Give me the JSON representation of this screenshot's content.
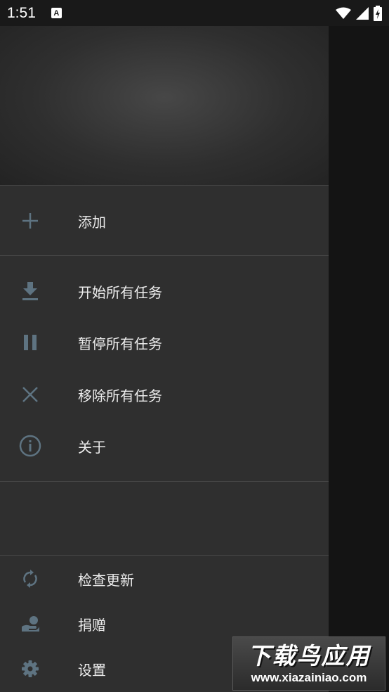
{
  "status_bar": {
    "time": "1:51",
    "notification_glyph": "A"
  },
  "drawer": {
    "add_label": "添加",
    "actions": [
      {
        "icon": "download-icon",
        "label": "开始所有任务"
      },
      {
        "icon": "pause-icon",
        "label": "暂停所有任务"
      },
      {
        "icon": "close-icon",
        "label": "移除所有任务"
      },
      {
        "icon": "info-icon",
        "label": "关于"
      }
    ],
    "footer": [
      {
        "icon": "sync-icon",
        "label": "检查更新"
      },
      {
        "icon": "donate-icon",
        "label": "捐赠"
      },
      {
        "icon": "gear-icon",
        "label": "设置"
      }
    ]
  },
  "watermark": {
    "title": "下载鸟应用",
    "url": "www.xiazainiao.com"
  },
  "colors": {
    "icon": "#5e7381",
    "drawer_bg": "#2f2f2f",
    "scrim": "#141414"
  }
}
